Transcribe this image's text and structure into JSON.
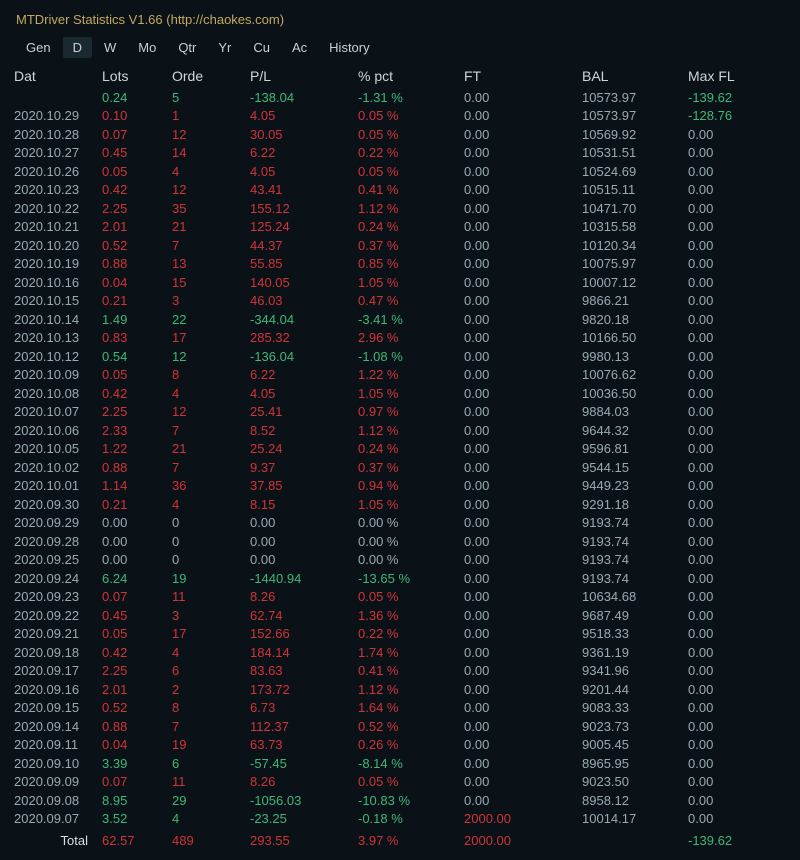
{
  "title": "MTDriver Statistics  V1.66  (http://chaokes.com)",
  "tabs": [
    "Gen",
    "D",
    "W",
    "Mo",
    "Qtr",
    "Yr",
    "Cu",
    "Ac",
    "History"
  ],
  "active_tab": 1,
  "headers": {
    "date": "Dat",
    "lots": "Lots",
    "orde": "Orde",
    "pl": "P/L",
    "pct": "% pct",
    "ft": "FT",
    "bal": "BAL",
    "max": "Max FL"
  },
  "summary": {
    "date": "",
    "lots": "0.24",
    "orde": "5",
    "pl": "-138.04",
    "pct": "-1.31 %",
    "ft": "0.00",
    "bal": "10573.97",
    "max": "-139.62",
    "cls": {
      "lots": "g",
      "orde": "g",
      "pl": "g",
      "pct": "g",
      "ft": "n",
      "bal": "n",
      "max": "g"
    }
  },
  "rows": [
    {
      "date": "2020.10.29",
      "lots": "0.10",
      "orde": "1",
      "pl": "4.05",
      "pct": "0.05 %",
      "ft": "0.00",
      "bal": "10573.97",
      "max": "-128.76",
      "cls": {
        "date": "n",
        "lots": "r",
        "orde": "r",
        "pl": "r",
        "pct": "r",
        "ft": "n",
        "bal": "n",
        "max": "g"
      }
    },
    {
      "date": "2020.10.28",
      "lots": "0.07",
      "orde": "12",
      "pl": "30.05",
      "pct": "0.05 %",
      "ft": "0.00",
      "bal": "10569.92",
      "max": "0.00",
      "cls": {
        "date": "n",
        "lots": "r",
        "orde": "r",
        "pl": "r",
        "pct": "r",
        "ft": "n",
        "bal": "n",
        "max": "n"
      }
    },
    {
      "date": "2020.10.27",
      "lots": "0.45",
      "orde": "14",
      "pl": "6.22",
      "pct": "0.22 %",
      "ft": "0.00",
      "bal": "10531.51",
      "max": "0.00",
      "cls": {
        "date": "n",
        "lots": "r",
        "orde": "r",
        "pl": "r",
        "pct": "r",
        "ft": "n",
        "bal": "n",
        "max": "n"
      }
    },
    {
      "date": "2020.10.26",
      "lots": "0.05",
      "orde": "4",
      "pl": "4.05",
      "pct": "0.05 %",
      "ft": "0.00",
      "bal": "10524.69",
      "max": "0.00",
      "cls": {
        "date": "n",
        "lots": "r",
        "orde": "r",
        "pl": "r",
        "pct": "r",
        "ft": "n",
        "bal": "n",
        "max": "n"
      }
    },
    {
      "date": "2020.10.23",
      "lots": "0.42",
      "orde": "12",
      "pl": "43.41",
      "pct": "0.41 %",
      "ft": "0.00",
      "bal": "10515.11",
      "max": "0.00",
      "cls": {
        "date": "n",
        "lots": "r",
        "orde": "r",
        "pl": "r",
        "pct": "r",
        "ft": "n",
        "bal": "n",
        "max": "n"
      }
    },
    {
      "date": "2020.10.22",
      "lots": "2.25",
      "orde": "35",
      "pl": "155.12",
      "pct": "1.12 %",
      "ft": "0.00",
      "bal": "10471.70",
      "max": "0.00",
      "cls": {
        "date": "n",
        "lots": "r",
        "orde": "r",
        "pl": "r",
        "pct": "r",
        "ft": "n",
        "bal": "n",
        "max": "n"
      }
    },
    {
      "date": "2020.10.21",
      "lots": "2.01",
      "orde": "21",
      "pl": "125.24",
      "pct": "0.24 %",
      "ft": "0.00",
      "bal": "10315.58",
      "max": "0.00",
      "cls": {
        "date": "n",
        "lots": "r",
        "orde": "r",
        "pl": "r",
        "pct": "r",
        "ft": "n",
        "bal": "n",
        "max": "n"
      }
    },
    {
      "date": "2020.10.20",
      "lots": "0.52",
      "orde": "7",
      "pl": "44.37",
      "pct": "0.37 %",
      "ft": "0.00",
      "bal": "10120.34",
      "max": "0.00",
      "cls": {
        "date": "n",
        "lots": "r",
        "orde": "r",
        "pl": "r",
        "pct": "r",
        "ft": "n",
        "bal": "n",
        "max": "n"
      }
    },
    {
      "date": "2020.10.19",
      "lots": "0.88",
      "orde": "13",
      "pl": "55.85",
      "pct": "0.85 %",
      "ft": "0.00",
      "bal": "10075.97",
      "max": "0.00",
      "cls": {
        "date": "n",
        "lots": "r",
        "orde": "r",
        "pl": "r",
        "pct": "r",
        "ft": "n",
        "bal": "n",
        "max": "n"
      }
    },
    {
      "date": "2020.10.16",
      "lots": "0.04",
      "orde": "15",
      "pl": "140.05",
      "pct": "1.05 %",
      "ft": "0.00",
      "bal": "10007.12",
      "max": "0.00",
      "cls": {
        "date": "n",
        "lots": "r",
        "orde": "r",
        "pl": "r",
        "pct": "r",
        "ft": "n",
        "bal": "n",
        "max": "n"
      }
    },
    {
      "date": "2020.10.15",
      "lots": "0.21",
      "orde": "3",
      "pl": "46.03",
      "pct": "0.47 %",
      "ft": "0.00",
      "bal": "9866.21",
      "max": "0.00",
      "cls": {
        "date": "n",
        "lots": "r",
        "orde": "r",
        "pl": "r",
        "pct": "r",
        "ft": "n",
        "bal": "n",
        "max": "n"
      }
    },
    {
      "date": "2020.10.14",
      "lots": "1.49",
      "orde": "22",
      "pl": "-344.04",
      "pct": "-3.41 %",
      "ft": "0.00",
      "bal": "9820.18",
      "max": "0.00",
      "cls": {
        "date": "n",
        "lots": "g",
        "orde": "g",
        "pl": "g",
        "pct": "g",
        "ft": "n",
        "bal": "n",
        "max": "n"
      }
    },
    {
      "date": "2020.10.13",
      "lots": "0.83",
      "orde": "17",
      "pl": "285.32",
      "pct": "2.96 %",
      "ft": "0.00",
      "bal": "10166.50",
      "max": "0.00",
      "cls": {
        "date": "n",
        "lots": "r",
        "orde": "r",
        "pl": "r",
        "pct": "r",
        "ft": "n",
        "bal": "n",
        "max": "n"
      }
    },
    {
      "date": "2020.10.12",
      "lots": "0.54",
      "orde": "12",
      "pl": "-136.04",
      "pct": "-1.08 %",
      "ft": "0.00",
      "bal": "9980.13",
      "max": "0.00",
      "cls": {
        "date": "n",
        "lots": "g",
        "orde": "g",
        "pl": "g",
        "pct": "g",
        "ft": "n",
        "bal": "n",
        "max": "n"
      }
    },
    {
      "date": "2020.10.09",
      "lots": "0.05",
      "orde": "8",
      "pl": "6.22",
      "pct": "1.22 %",
      "ft": "0.00",
      "bal": "10076.62",
      "max": "0.00",
      "cls": {
        "date": "n",
        "lots": "r",
        "orde": "r",
        "pl": "r",
        "pct": "r",
        "ft": "n",
        "bal": "n",
        "max": "n"
      }
    },
    {
      "date": "2020.10.08",
      "lots": "0.42",
      "orde": "4",
      "pl": "4.05",
      "pct": "1.05 %",
      "ft": "0.00",
      "bal": "10036.50",
      "max": "0.00",
      "cls": {
        "date": "n",
        "lots": "r",
        "orde": "r",
        "pl": "r",
        "pct": "r",
        "ft": "n",
        "bal": "n",
        "max": "n"
      }
    },
    {
      "date": "2020.10.07",
      "lots": "2.25",
      "orde": "12",
      "pl": "25.41",
      "pct": "0.97 %",
      "ft": "0.00",
      "bal": "9884.03",
      "max": "0.00",
      "cls": {
        "date": "n",
        "lots": "r",
        "orde": "r",
        "pl": "r",
        "pct": "r",
        "ft": "n",
        "bal": "n",
        "max": "n"
      }
    },
    {
      "date": "2020.10.06",
      "lots": "2.33",
      "orde": "7",
      "pl": "8.52",
      "pct": "1.12 %",
      "ft": "0.00",
      "bal": "9644.32",
      "max": "0.00",
      "cls": {
        "date": "n",
        "lots": "r",
        "orde": "r",
        "pl": "r",
        "pct": "r",
        "ft": "n",
        "bal": "n",
        "max": "n"
      }
    },
    {
      "date": "2020.10.05",
      "lots": "1.22",
      "orde": "21",
      "pl": "25.24",
      "pct": "0.24 %",
      "ft": "0.00",
      "bal": "9596.81",
      "max": "0.00",
      "cls": {
        "date": "n",
        "lots": "r",
        "orde": "r",
        "pl": "r",
        "pct": "r",
        "ft": "n",
        "bal": "n",
        "max": "n"
      }
    },
    {
      "date": "2020.10.02",
      "lots": "0.88",
      "orde": "7",
      "pl": "9.37",
      "pct": "0.37 %",
      "ft": "0.00",
      "bal": "9544.15",
      "max": "0.00",
      "cls": {
        "date": "n",
        "lots": "r",
        "orde": "r",
        "pl": "r",
        "pct": "r",
        "ft": "n",
        "bal": "n",
        "max": "n"
      }
    },
    {
      "date": "2020.10.01",
      "lots": "1.14",
      "orde": "36",
      "pl": "37.85",
      "pct": "0.94 %",
      "ft": "0.00",
      "bal": "9449.23",
      "max": "0.00",
      "cls": {
        "date": "n",
        "lots": "r",
        "orde": "r",
        "pl": "r",
        "pct": "r",
        "ft": "n",
        "bal": "n",
        "max": "n"
      }
    },
    {
      "date": "2020.09.30",
      "lots": "0.21",
      "orde": "4",
      "pl": "8.15",
      "pct": "1.05 %",
      "ft": "0.00",
      "bal": "9291.18",
      "max": "0.00",
      "cls": {
        "date": "n",
        "lots": "r",
        "orde": "r",
        "pl": "r",
        "pct": "r",
        "ft": "n",
        "bal": "n",
        "max": "n"
      }
    },
    {
      "date": "2020.09.29",
      "lots": "0.00",
      "orde": "0",
      "pl": "0.00",
      "pct": "0.00 %",
      "ft": "0.00",
      "bal": "9193.74",
      "max": "0.00",
      "cls": {
        "date": "n",
        "lots": "n",
        "orde": "n",
        "pl": "n",
        "pct": "n",
        "ft": "n",
        "bal": "n",
        "max": "n"
      }
    },
    {
      "date": "2020.09.28",
      "lots": "0.00",
      "orde": "0",
      "pl": "0.00",
      "pct": "0.00 %",
      "ft": "0.00",
      "bal": "9193.74",
      "max": "0.00",
      "cls": {
        "date": "n",
        "lots": "n",
        "orde": "n",
        "pl": "n",
        "pct": "n",
        "ft": "n",
        "bal": "n",
        "max": "n"
      }
    },
    {
      "date": "2020.09.25",
      "lots": "0.00",
      "orde": "0",
      "pl": "0.00",
      "pct": "0.00 %",
      "ft": "0.00",
      "bal": "9193.74",
      "max": "0.00",
      "cls": {
        "date": "n",
        "lots": "n",
        "orde": "n",
        "pl": "n",
        "pct": "n",
        "ft": "n",
        "bal": "n",
        "max": "n"
      }
    },
    {
      "date": "2020.09.24",
      "lots": "6.24",
      "orde": "19",
      "pl": "-1440.94",
      "pct": "-13.65 %",
      "ft": "0.00",
      "bal": "9193.74",
      "max": "0.00",
      "cls": {
        "date": "n",
        "lots": "g",
        "orde": "g",
        "pl": "g",
        "pct": "g",
        "ft": "n",
        "bal": "n",
        "max": "n"
      }
    },
    {
      "date": "2020.09.23",
      "lots": "0.07",
      "orde": "11",
      "pl": "8.26",
      "pct": "0.05 %",
      "ft": "0.00",
      "bal": "10634.68",
      "max": "0.00",
      "cls": {
        "date": "n",
        "lots": "r",
        "orde": "r",
        "pl": "r",
        "pct": "r",
        "ft": "n",
        "bal": "n",
        "max": "n"
      }
    },
    {
      "date": "2020.09.22",
      "lots": "0.45",
      "orde": "3",
      "pl": "62.74",
      "pct": "1.36 %",
      "ft": "0.00",
      "bal": "9687.49",
      "max": "0.00",
      "cls": {
        "date": "n",
        "lots": "r",
        "orde": "r",
        "pl": "r",
        "pct": "r",
        "ft": "n",
        "bal": "n",
        "max": "n"
      }
    },
    {
      "date": "2020.09.21",
      "lots": "0.05",
      "orde": "17",
      "pl": "152.66",
      "pct": "0.22 %",
      "ft": "0.00",
      "bal": "9518.33",
      "max": "0.00",
      "cls": {
        "date": "n",
        "lots": "r",
        "orde": "r",
        "pl": "r",
        "pct": "r",
        "ft": "n",
        "bal": "n",
        "max": "n"
      }
    },
    {
      "date": "2020.09.18",
      "lots": "0.42",
      "orde": "4",
      "pl": "184.14",
      "pct": "1.74 %",
      "ft": "0.00",
      "bal": "9361.19",
      "max": "0.00",
      "cls": {
        "date": "n",
        "lots": "r",
        "orde": "r",
        "pl": "r",
        "pct": "r",
        "ft": "n",
        "bal": "n",
        "max": "n"
      }
    },
    {
      "date": "2020.09.17",
      "lots": "2.25",
      "orde": "6",
      "pl": "83.63",
      "pct": "0.41 %",
      "ft": "0.00",
      "bal": "9341.96",
      "max": "0.00",
      "cls": {
        "date": "n",
        "lots": "r",
        "orde": "r",
        "pl": "r",
        "pct": "r",
        "ft": "n",
        "bal": "n",
        "max": "n"
      }
    },
    {
      "date": "2020.09.16",
      "lots": "2.01",
      "orde": "2",
      "pl": "173.72",
      "pct": "1.12 %",
      "ft": "0.00",
      "bal": "9201.44",
      "max": "0.00",
      "cls": {
        "date": "n",
        "lots": "r",
        "orde": "r",
        "pl": "r",
        "pct": "r",
        "ft": "n",
        "bal": "n",
        "max": "n"
      }
    },
    {
      "date": "2020.09.15",
      "lots": "0.52",
      "orde": "8",
      "pl": "6.73",
      "pct": "1.64 %",
      "ft": "0.00",
      "bal": "9083.33",
      "max": "0.00",
      "cls": {
        "date": "n",
        "lots": "r",
        "orde": "r",
        "pl": "r",
        "pct": "r",
        "ft": "n",
        "bal": "n",
        "max": "n"
      }
    },
    {
      "date": "2020.09.14",
      "lots": "0.88",
      "orde": "7",
      "pl": "112.37",
      "pct": "0.52 %",
      "ft": "0.00",
      "bal": "9023.73",
      "max": "0.00",
      "cls": {
        "date": "n",
        "lots": "r",
        "orde": "r",
        "pl": "r",
        "pct": "r",
        "ft": "n",
        "bal": "n",
        "max": "n"
      }
    },
    {
      "date": "2020.09.11",
      "lots": "0.04",
      "orde": "19",
      "pl": "63.73",
      "pct": "0.26 %",
      "ft": "0.00",
      "bal": "9005.45",
      "max": "0.00",
      "cls": {
        "date": "n",
        "lots": "r",
        "orde": "r",
        "pl": "r",
        "pct": "r",
        "ft": "n",
        "bal": "n",
        "max": "n"
      }
    },
    {
      "date": "2020.09.10",
      "lots": "3.39",
      "orde": "6",
      "pl": "-57.45",
      "pct": "-8.14 %",
      "ft": "0.00",
      "bal": "8965.95",
      "max": "0.00",
      "cls": {
        "date": "n",
        "lots": "g",
        "orde": "g",
        "pl": "g",
        "pct": "g",
        "ft": "n",
        "bal": "n",
        "max": "n"
      }
    },
    {
      "date": "2020.09.09",
      "lots": "0.07",
      "orde": "11",
      "pl": "8.26",
      "pct": "0.05 %",
      "ft": "0.00",
      "bal": "9023.50",
      "max": "0.00",
      "cls": {
        "date": "n",
        "lots": "r",
        "orde": "r",
        "pl": "r",
        "pct": "r",
        "ft": "n",
        "bal": "n",
        "max": "n"
      }
    },
    {
      "date": "2020.09.08",
      "lots": "8.95",
      "orde": "29",
      "pl": "-1056.03",
      "pct": "-10.83 %",
      "ft": "0.00",
      "bal": "8958.12",
      "max": "0.00",
      "cls": {
        "date": "n",
        "lots": "g",
        "orde": "g",
        "pl": "g",
        "pct": "g",
        "ft": "n",
        "bal": "n",
        "max": "n"
      }
    },
    {
      "date": "2020.09.07",
      "lots": "3.52",
      "orde": "4",
      "pl": "-23.25",
      "pct": "-0.18 %",
      "ft": "2000.00",
      "bal": "10014.17",
      "max": "0.00",
      "cls": {
        "date": "n",
        "lots": "g",
        "orde": "g",
        "pl": "g",
        "pct": "g",
        "ft": "r",
        "bal": "n",
        "max": "n"
      }
    }
  ],
  "total": {
    "label": "Total",
    "lots": "62.57",
    "orde": "489",
    "pl": "293.55",
    "pct": "3.97 %",
    "ft": "2000.00",
    "bal": "",
    "max": "-139.62",
    "cls": {
      "lots": "r",
      "orde": "r",
      "pl": "r",
      "pct": "r",
      "ft": "r",
      "bal": "n",
      "max": "g"
    }
  }
}
